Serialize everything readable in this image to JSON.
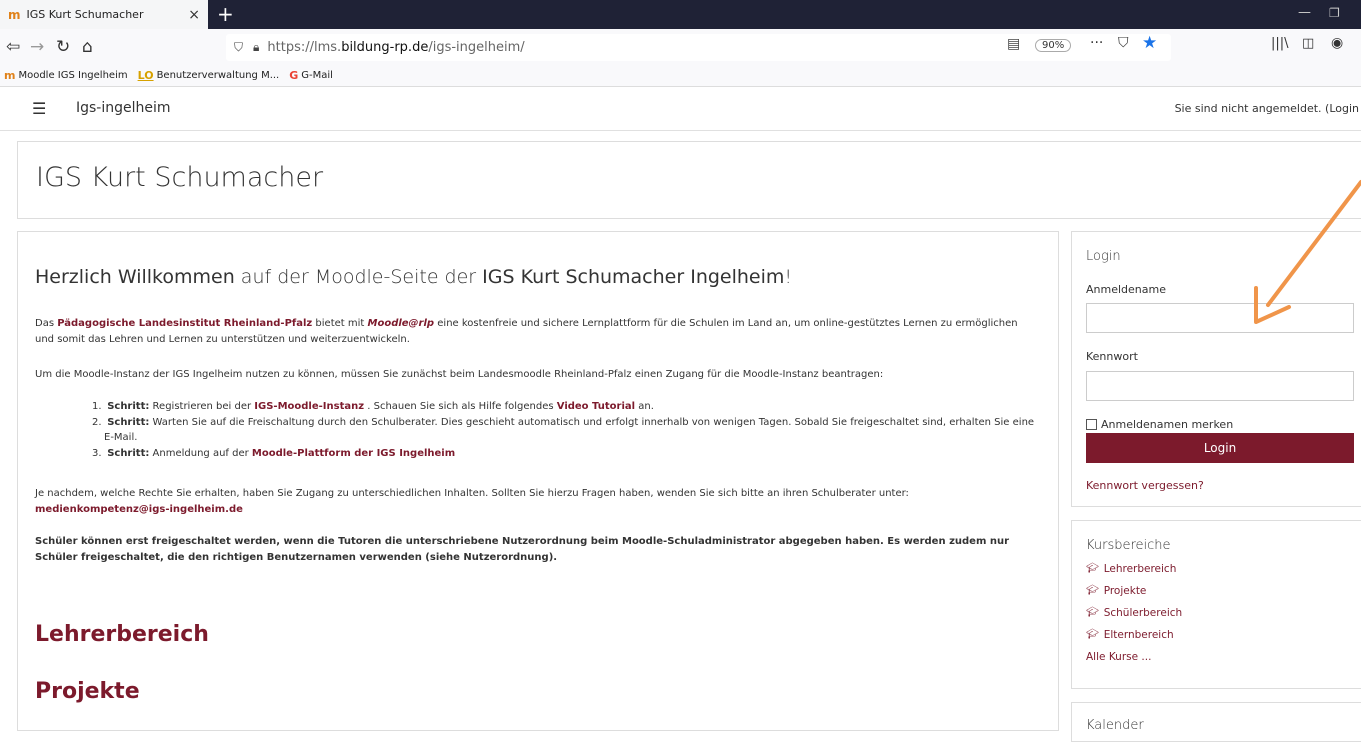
{
  "browser": {
    "tab": {
      "title": "IGS Kurt Schumacher",
      "favicon": "m",
      "close": "×"
    },
    "new_tab": "+",
    "url": {
      "prefix": "https://lms.",
      "host": "bildung-rp.de",
      "path": "/igs-ingelheim/"
    },
    "zoom": "90%",
    "more": "···",
    "bookmarks": [
      {
        "icon": "m",
        "label": "Moodle IGS Ingelheim"
      },
      {
        "icon": "LO",
        "label": "Benutzerverwaltung M..."
      },
      {
        "icon": "G",
        "label": "G-Mail"
      }
    ]
  },
  "header": {
    "site_name": "Igs-ingelheim",
    "login_status": "Sie sind nicht angemeldet. (Login"
  },
  "page": {
    "title": "IGS Kurt Schumacher"
  },
  "main": {
    "welcome": {
      "part1": "Herzlich Willkommen",
      "part2": " auf der Moodle-Seite der ",
      "part3": "IGS Kurt Schumacher Ingelheim",
      "part4": "!"
    },
    "intro": {
      "t1": "Das ",
      "link1": "Pädagogische Landesinstitut Rheinland-Pfalz",
      "t2": " bietet mit ",
      "link2": "Moodle@rlp",
      "t3": " eine kostenfreie und sichere Lernplattform für die Schulen im Land an, um online-gestütztes Lernen zu ermöglichen und somit das Lehren und Lernen zu unterstützen und weiterzuentwickeln."
    },
    "para2": "Um die Moodle-Instanz der IGS Ingelheim nutzen zu können, müssen Sie zunächst beim Landesmoodle Rheinland-Pfalz einen Zugang für die Moodle-Instanz beantragen:",
    "steps": [
      {
        "num": "1.",
        "bold": "Schritt:",
        "t1": " Registrieren bei der ",
        "link": "IGS-Moodle-Instanz",
        "t2": " . Schauen Sie sich als Hilfe folgendes ",
        "link2": "Video Tutorial",
        "t3": " an."
      },
      {
        "num": "2.",
        "bold": "Schritt:",
        "t1": " Warten Sie auf die Freischaltung durch den Schulberater. Dies geschieht automatisch und erfolgt innerhalb von wenigen Tagen. Sobald Sie freigeschaltet sind, erhalten Sie eine E-Mail."
      },
      {
        "num": "3.",
        "bold": "Schritt:",
        "t1": " Anmeldung auf der ",
        "link": "Moodle-Plattform der IGS Ingelheim"
      }
    ],
    "para3": "Je nachdem, welche Rechte Sie erhalten, haben Sie Zugang zu unterschiedlichen Inhalten. Sollten Sie hierzu Fragen haben, wenden Sie sich bitte an ihren Schulberater unter:",
    "email": "medienkompetenz@igs-ingelheim.de",
    "para4": "Schüler können erst freigeschaltet werden, wenn die Tutoren die unterschriebene Nutzerordnung beim Moodle-Schuladministrator abgegeben haben. Es werden zudem nur Schüler freigeschaltet, die den richtigen Benutzernamen verwenden (siehe Nutzerordnung).",
    "sections": [
      "Lehrerbereich",
      "Projekte"
    ]
  },
  "login_block": {
    "title": "Login",
    "username_label": "Anmeldename",
    "password_label": "Kennwort",
    "remember_label": "Anmeldenamen merken",
    "button": "Login",
    "forgot": "Kennwort vergessen?"
  },
  "courses_block": {
    "title": "Kursbereiche",
    "items": [
      "Lehrerbereich",
      "Projekte",
      "Schülerbereich",
      "Elternbereich"
    ],
    "all": "Alle Kurse ..."
  },
  "calendar_block": {
    "title": "Kalender"
  },
  "colors": {
    "brand": "#7c1a2c",
    "annotation_arrow": "#f0954a",
    "titlebar": "#1f2236"
  }
}
